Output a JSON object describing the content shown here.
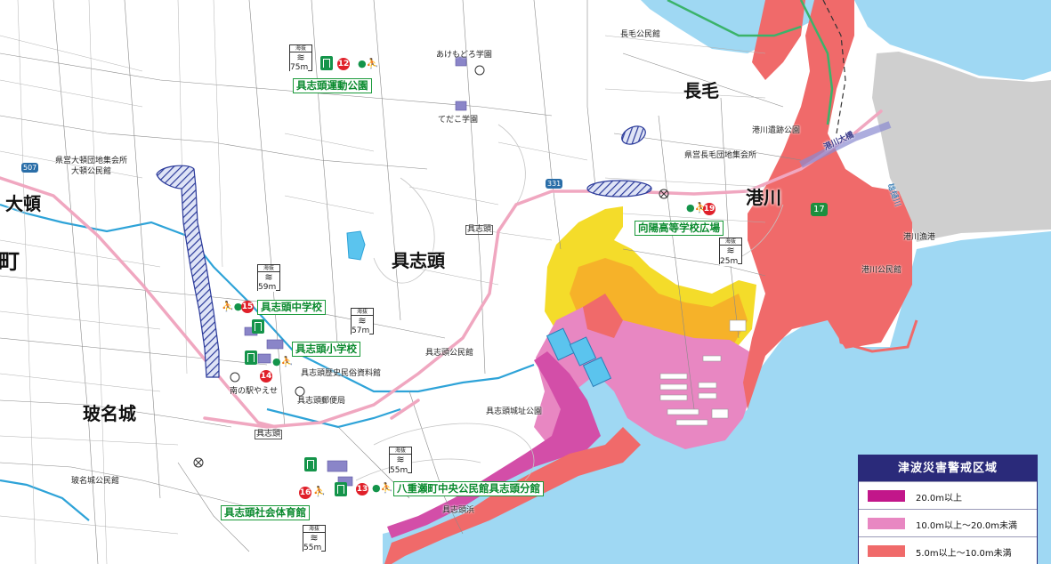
{
  "map": {
    "area_labels": [
      {
        "key": "nagake",
        "text": "長毛"
      },
      {
        "key": "minatogawa",
        "text": "港川"
      },
      {
        "key": "ooshiomi",
        "text": "大頓"
      },
      {
        "key": "gushichan",
        "text": "具志頭"
      },
      {
        "key": "hanashiro",
        "text": "玻名城"
      },
      {
        "key": "edge_machi",
        "text": "町"
      }
    ],
    "place_labels": [
      {
        "key": "nagake_kouminkan",
        "text": "長毛公民館"
      },
      {
        "key": "akemodoro",
        "text": "あけもどろ学園"
      },
      {
        "key": "tedako",
        "text": "てだこ学園"
      },
      {
        "key": "minatogawa_iseki",
        "text": "港川遺跡公園"
      },
      {
        "key": "kenei_nagake",
        "text": "県営長毛団地集会所"
      },
      {
        "key": "kenei_ooshiomi",
        "text": "県営大頓団地集会所"
      },
      {
        "key": "ooshiomi_kouminkan",
        "text": "大頓公民館"
      },
      {
        "key": "minatogawa_gyokou",
        "text": "港川漁港"
      },
      {
        "key": "minatogawa_kouminkan",
        "text": "港川公民館"
      },
      {
        "key": "gushichan_kouminkan",
        "text": "具志頭公民館"
      },
      {
        "key": "rekishi_shiryoukan",
        "text": "具志頭歴史民俗資料館"
      },
      {
        "key": "michinoeki",
        "text": "南の駅やえせ"
      },
      {
        "key": "yuubinkyoku",
        "text": "具志頭郵便局"
      },
      {
        "key": "joushi",
        "text": "具志頭城址公園"
      },
      {
        "key": "hanashiro_kouminkan",
        "text": "玻名城公民館"
      },
      {
        "key": "gushichan_hama",
        "text": "具志頭浜"
      },
      {
        "key": "bridge",
        "text": "港川大橋"
      },
      {
        "key": "river",
        "text": "雄樋川"
      }
    ],
    "facilities": [
      {
        "key": "undou",
        "text": "具志頭運動公園",
        "number": "12",
        "elevation": "75m"
      },
      {
        "key": "kouyou",
        "text": "向陽高等学校広場",
        "number": "19",
        "elevation": "25m"
      },
      {
        "key": "chuugakkou",
        "text": "具志頭中学校",
        "number": "15",
        "elevation": "59m"
      },
      {
        "key": "shougakkou",
        "text": "具志頭小学校",
        "number": "14",
        "elevation": "57m"
      },
      {
        "key": "kouminkan_bunkan",
        "text": "八重瀬町中央公民館具志頭分館",
        "number": "13",
        "elevation": "55m"
      },
      {
        "key": "taiikukan",
        "text": "具志頭社会体育館",
        "number": "16",
        "elevation": "55m"
      }
    ],
    "sign_header": "海抜",
    "road_numbers": {
      "r507": "507",
      "r331": "331",
      "r17": "17"
    },
    "bus_stop": "具志頭",
    "bus_stop2": "具志頭"
  },
  "legend": {
    "title": "津波災害警戒区域",
    "items": [
      {
        "label": "20.0m以上",
        "color": "#c2168a"
      },
      {
        "label": "10.0m以上～20.0m未満",
        "color": "#e887c2"
      },
      {
        "label": "5.0m以上～10.0m未満",
        "color": "#f06a6a"
      }
    ]
  },
  "colors": {
    "sea": "#9fd8f3",
    "river": "#2ea3d8",
    "road_major": "#f0a7c0",
    "zone_yellow": "#f4dc2a",
    "zone_orange": "#f6b229",
    "zone_red": "#f06a6a",
    "zone_pink": "#e887c2",
    "zone_magenta": "#d34ea8",
    "hatch": "#2b3a9a",
    "facility": "#14944a",
    "gray_land": "#cfcfcf"
  }
}
